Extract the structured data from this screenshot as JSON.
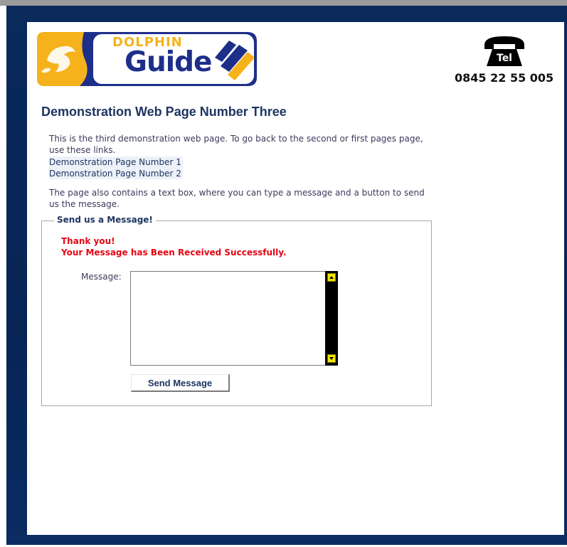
{
  "header": {
    "logo_top_word": "DOLPHIN",
    "logo_main_word": "Guide",
    "phone_icon_label": "Tel",
    "phone_number": "0845 22 55 005"
  },
  "main": {
    "title": "Demonstration Web Page Number Three",
    "intro": "This is the third demonstration web page. To go back to the second or first pages page, use these links.",
    "links": [
      {
        "label": "Demonstration Page Number 1"
      },
      {
        "label": "Demonstration Page Number 2"
      }
    ],
    "description": "The page also contains a text box, where you can type a message and a button to send us the message."
  },
  "form": {
    "legend": "Send us a Message!",
    "thanks_line1": "Thank you!",
    "thanks_line2": "Your Message has Been Received Successfully.",
    "message_label": "Message:",
    "message_value": "",
    "send_label": "Send Message"
  },
  "colors": {
    "frame_navy": "#0a2a5c",
    "logo_yellow": "#f5b21b",
    "logo_blue": "#1e2f8a",
    "title_blue": "#1d3561",
    "success_red": "#e30613",
    "scroll_yellow": "#f4e600"
  },
  "icons": {
    "logo_icon": "dolphin-logo-icon",
    "phone_icon": "telephone-icon"
  }
}
